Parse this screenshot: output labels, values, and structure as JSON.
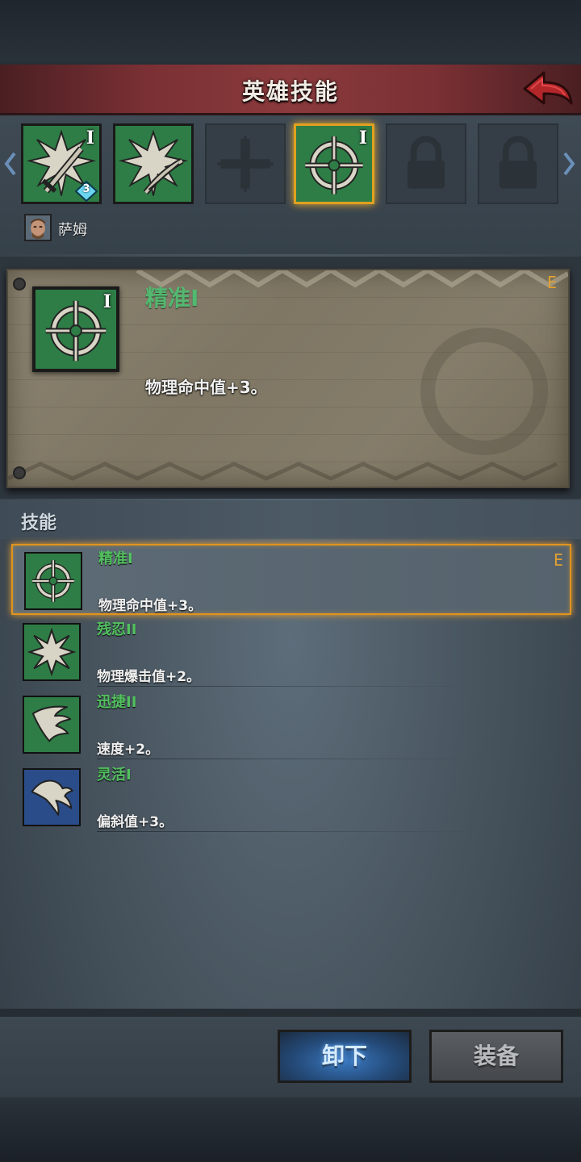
{
  "header": {
    "title": "英雄技能"
  },
  "slots": [
    {
      "type": "skill",
      "icon": "burst-sword-icon",
      "rank": "I",
      "gem_count": "3"
    },
    {
      "type": "skill",
      "icon": "burst-bow-icon"
    },
    {
      "type": "empty",
      "icon": "cross-icon"
    },
    {
      "type": "skill",
      "icon": "crosshair-icon",
      "rank": "I",
      "selected": true
    },
    {
      "type": "locked",
      "icon": "lock-icon"
    },
    {
      "type": "locked",
      "icon": "lock-icon"
    }
  ],
  "hero": {
    "name": "萨姆"
  },
  "detail": {
    "title": "精准I",
    "rank": "I",
    "description": "物理命中值+3。",
    "grade": "E"
  },
  "skills_section": {
    "title": "技能"
  },
  "skills": [
    {
      "name": "精准I",
      "description": "物理命中值+3。",
      "icon": "crosshair-icon",
      "grade": "E",
      "selected": true,
      "color": "#2e7d46"
    },
    {
      "name": "残忍II",
      "description": "物理爆击值+2。",
      "icon": "burst-icon",
      "color": "#2e7d46"
    },
    {
      "name": "迅捷II",
      "description": "速度+2。",
      "icon": "wing-icon",
      "color": "#2e7d46"
    },
    {
      "name": "灵活I",
      "description": "偏斜值+3。",
      "icon": "feather-icon",
      "color": "#2a4d8a"
    }
  ],
  "buttons": {
    "unequip": "卸下",
    "equip": "装备"
  },
  "colors": {
    "accent": "#e0a020",
    "skill_name": "#53c060",
    "header": "#7a3034"
  }
}
